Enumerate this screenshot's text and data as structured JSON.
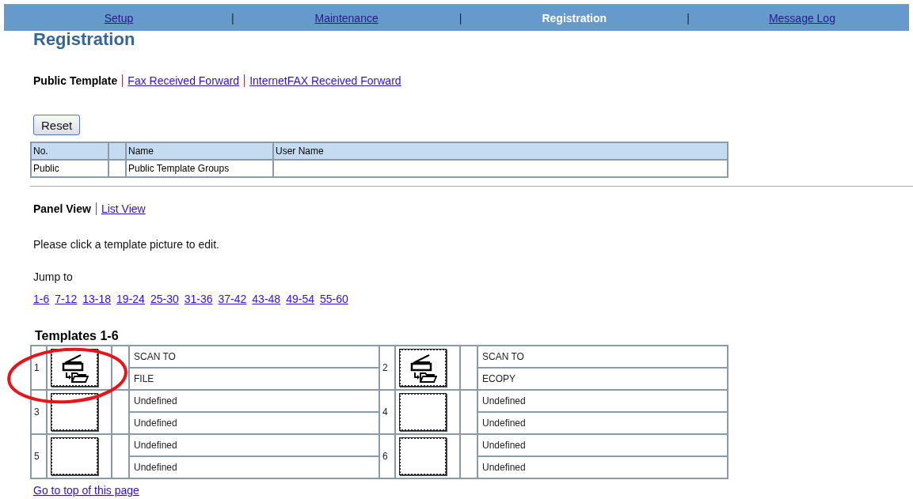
{
  "nav": [
    {
      "label": "Setup",
      "selected": false
    },
    {
      "label": "Maintenance",
      "selected": false
    },
    {
      "label": "Registration",
      "selected": true
    },
    {
      "label": "Message Log",
      "selected": false
    }
  ],
  "nav_separator": "|",
  "title": "Registration",
  "sub_tabs": [
    {
      "label": "Public Template",
      "selected": true
    },
    {
      "label": "Fax Received Forward",
      "selected": false
    },
    {
      "label": "InternetFAX Received Forward",
      "selected": false
    }
  ],
  "reset_button": "Reset",
  "group_table": {
    "columns": [
      "No.",
      "",
      "Name",
      "User Name"
    ],
    "rows": [
      [
        "Public",
        "",
        "Public Template Groups",
        ""
      ]
    ]
  },
  "view_tabs": [
    {
      "label": "Panel View",
      "selected": true
    },
    {
      "label": "List View",
      "selected": false
    }
  ],
  "instruction": "Please click a template picture to edit.",
  "jump_label": "Jump to",
  "jump_links": [
    "1-6",
    "7-12",
    "13-18",
    "19-24",
    "25-30",
    "31-36",
    "37-42",
    "43-48",
    "49-54",
    "55-60"
  ],
  "templates_heading": "Templates 1-6",
  "templates": [
    {
      "number": "1",
      "kind": "scan",
      "line_1": "SCAN TO",
      "line_2": "FILE"
    },
    {
      "number": "2",
      "kind": "scan",
      "line_1": "SCAN TO",
      "line_2": "ECOPY"
    },
    {
      "number": "3",
      "kind": "empty",
      "line_1": "Undefined",
      "line_2": "Undefined"
    },
    {
      "number": "4",
      "kind": "empty",
      "line_1": "Undefined",
      "line_2": "Undefined"
    },
    {
      "number": "5",
      "kind": "empty",
      "line_1": "Undefined",
      "line_2": "Undefined"
    },
    {
      "number": "6",
      "kind": "empty",
      "line_1": "Undefined",
      "line_2": "Undefined"
    }
  ],
  "annotation": {
    "kind": "ellipse"
  },
  "top_link": "Go to top of this page"
}
